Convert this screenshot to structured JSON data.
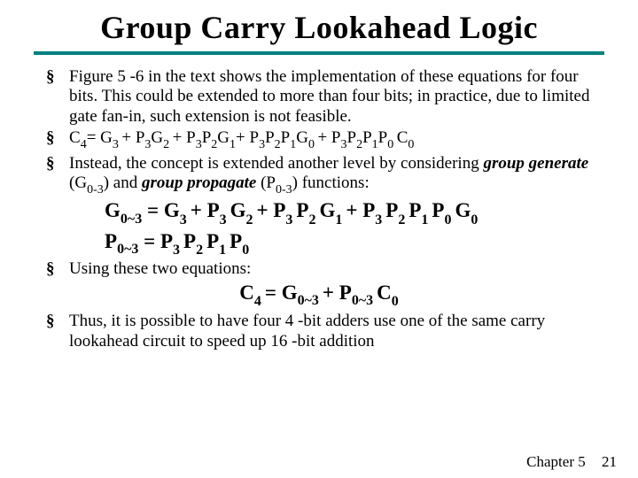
{
  "title": "Group Carry Lookahead Logic",
  "bullets": {
    "b1": "Figure 5 -6 in the text shows the implementation of these equations for four bits. This could be extended to more than four bits; in practice, due to limited gate fan-in, such extension is not feasible.",
    "b2_plain": "C",
    "b2_s1": "4",
    "b2_eq": "= G",
    "b2_s2": "3 ",
    "b2_t1": "+ P",
    "b2_s3": "3",
    "b2_t2": "G",
    "b2_s4": "2 ",
    "b2_t3": "+ P",
    "b2_s5": "3",
    "b2_t4": "P",
    "b2_s6": "2",
    "b2_t5": "G",
    "b2_s7": "1",
    "b2_t6": "+ P",
    "b2_s8": "3",
    "b2_t7": "P",
    "b2_s9": "2",
    "b2_t8": "P",
    "b2_s10": "1",
    "b2_t9": "G",
    "b2_s11": "0 ",
    "b2_t10": "+ P",
    "b2_s12": "3",
    "b2_t11": "P",
    "b2_s13": "2",
    "b2_t12": "P",
    "b2_s14": "1",
    "b2_t13": "P",
    "b2_s15": "0 ",
    "b2_t14": "C",
    "b2_s16": "0",
    "b3_a": "Instead, the concept is extended another level by considering ",
    "b3_gg": "group generate",
    "b3_b": " (G",
    "b3_s1": "0-3",
    "b3_c": ") and ",
    "b3_gp": "group propagate",
    "b3_d": " (P",
    "b3_s2": "0-3",
    "b3_e": ") functions:",
    "b4": "Using these two equations:",
    "b5": "Thus, it is possible to have four 4 -bit adders use one of the same carry lookahead circuit to speed up 16 -bit addition"
  },
  "eq1": {
    "G": "G",
    "s03a": "0~3",
    "eq": " = G",
    "s3": "3 ",
    "p1": "+ P",
    "s3b": "3 ",
    "g2": "G",
    "s2": "2 ",
    "p2": "+ P",
    "s3c": "3 ",
    "p2b": "P",
    "s2b": "2 ",
    "g1": "G",
    "s1": "1 ",
    "p3": "+ P",
    "s3d": "3 ",
    "p3b": "P",
    "s2c": "2 ",
    "p3c": "P",
    "s1b": "1 ",
    "p3d": "P",
    "s0": "0 ",
    "g0": "G",
    "s0b": "0"
  },
  "eq2": {
    "P": "P",
    "s03": "0~3",
    "eq": " = P",
    "s3": "3 ",
    "p2": "P",
    "s2": "2 ",
    "p1": "P",
    "s1": "1 ",
    "p0": "P",
    "s0": "0"
  },
  "eq3": {
    "C": "C",
    "s4": "4 ",
    "eq": "= G",
    "s03a": "0~3 ",
    "plus": "+ P",
    "s03b": "0~3 ",
    "c0": "C",
    "s0": "0"
  },
  "footer": {
    "chapter": "Chapter 5",
    "page": "21"
  }
}
